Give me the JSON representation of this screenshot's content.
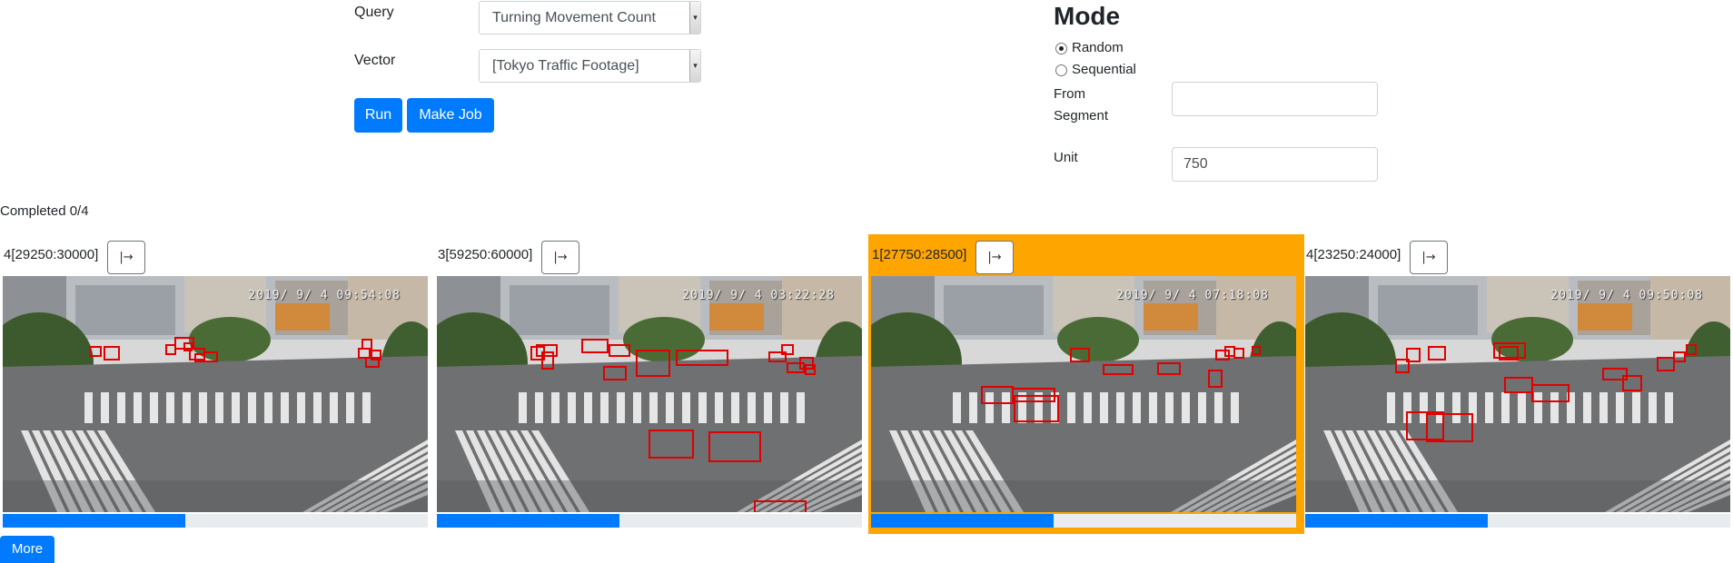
{
  "form": {
    "query_label": "Query",
    "query_value": "Turning Movement Count",
    "vector_label": "Vector",
    "vector_value": "[Tokyo Traffic Footage]",
    "run_label": "Run",
    "make_job_label": "Make Job"
  },
  "mode": {
    "title": "Mode",
    "options": [
      {
        "label": "Random",
        "checked": true
      },
      {
        "label": "Sequential",
        "checked": false
      }
    ],
    "from_segment_label_line1": "From",
    "from_segment_label_line2": "Segment",
    "from_segment_value": "",
    "unit_label": "Unit",
    "unit_value": "750"
  },
  "status": {
    "completed_text": "Completed 0/4"
  },
  "segments": [
    {
      "label": "4[29250:30000]",
      "button_glyph": "|→",
      "timestamp": "2019/ 9/ 4 09:54:08",
      "progress": 0.43,
      "selected": false,
      "detections": 12
    },
    {
      "label": "3[59250:60000]",
      "button_glyph": "|→",
      "timestamp": "2019/ 9/ 4 03:22:28",
      "progress": 0.43,
      "selected": false,
      "detections": 16
    },
    {
      "label": "1[27750:28500]",
      "button_glyph": "|→",
      "timestamp": "2019/ 9/ 4 07:18:08",
      "progress": 0.43,
      "selected": true,
      "detections": 11
    },
    {
      "label": "4[23250:24000]",
      "button_glyph": "|→",
      "timestamp": "2019/ 9/ 4 09:50:08",
      "progress": 0.43,
      "selected": false,
      "detections": 14
    }
  ],
  "more_label": "More",
  "colors": {
    "primary": "#007bff",
    "selected_border": "#ffa500",
    "detection_box": "#e00000",
    "progress_track": "#e9ecef"
  },
  "icons": {
    "segment_button": "jump-to-end-icon"
  }
}
